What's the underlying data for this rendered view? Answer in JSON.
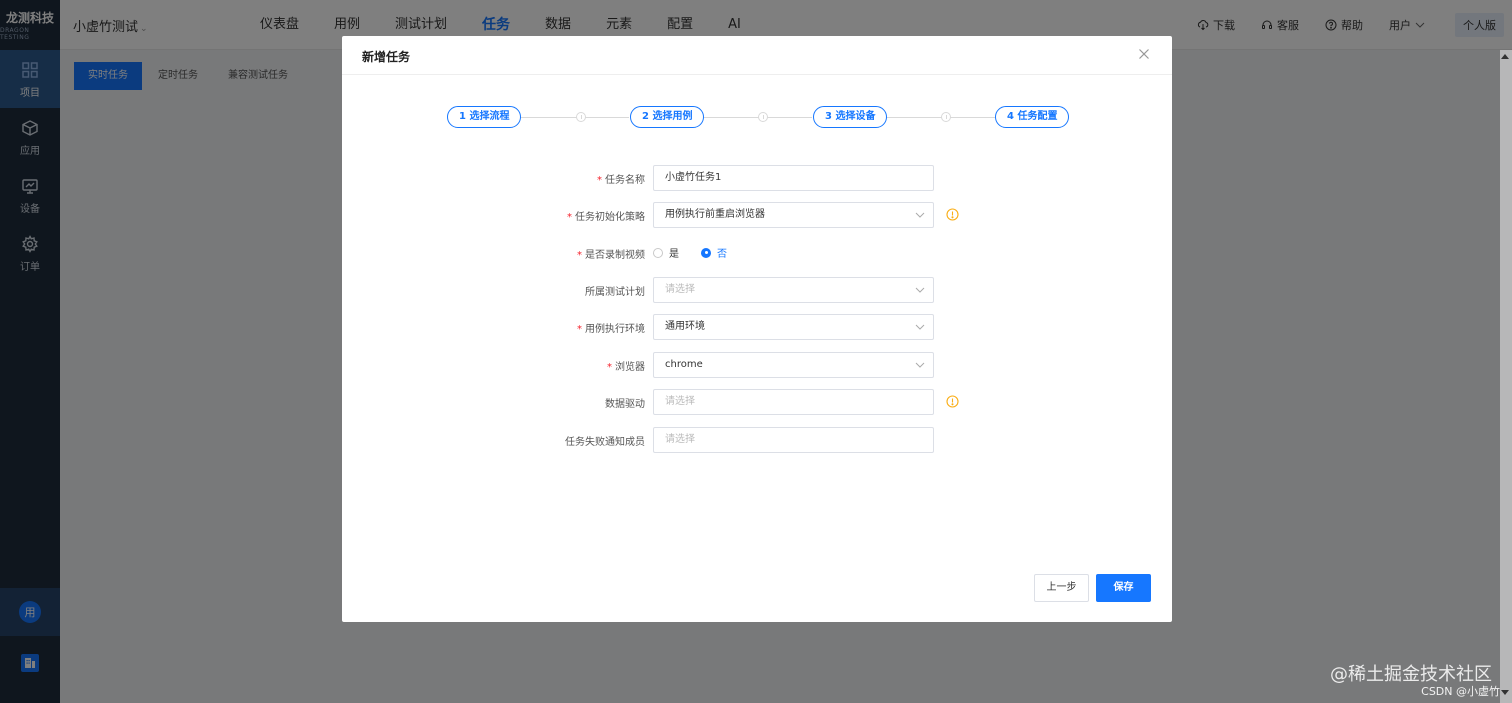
{
  "app": {
    "logo_text": "龙测科技",
    "logo_subtext": "DRAGON TESTING",
    "project_name": "小虚竹测试"
  },
  "sidebar": {
    "items": [
      {
        "label": "项目",
        "icon": "grid-icon",
        "active": true
      },
      {
        "label": "应用",
        "icon": "cube-icon",
        "active": false
      },
      {
        "label": "设备",
        "icon": "monitor-icon",
        "active": false
      },
      {
        "label": "订单",
        "icon": "gear-icon",
        "active": false
      }
    ],
    "user_avatar": "用"
  },
  "nav": {
    "items": [
      "仪表盘",
      "用例",
      "测试计划",
      "任务",
      "数据",
      "元素",
      "配置",
      "AI"
    ],
    "active": "任务"
  },
  "toolbar": {
    "download": "下载",
    "support": "客服",
    "help": "帮助",
    "user": "用户",
    "version": "个人版"
  },
  "subtabs": [
    "实时任务",
    "定时任务",
    "兼容测试任务"
  ],
  "modal": {
    "title": "新增任务",
    "steps": [
      "1 选择流程",
      "2 选择用例",
      "3 选择设备",
      "4 任务配置"
    ],
    "form": {
      "task_name": {
        "label": "任务名称",
        "value": "小虚竹任务1"
      },
      "init_strategy": {
        "label": "任务初始化策略",
        "value": "用例执行前重启浏览器"
      },
      "record_video": {
        "label": "是否录制视频",
        "options": [
          "是",
          "否"
        ],
        "selected": "否"
      },
      "test_plan": {
        "label": "所属测试计划",
        "placeholder": "请选择"
      },
      "environment": {
        "label": "用例执行环境",
        "value": "通用环境"
      },
      "browser": {
        "label": "浏览器",
        "value": "chrome"
      },
      "data_driven": {
        "label": "数据驱动",
        "placeholder": "请选择"
      },
      "notify_members": {
        "label": "任务失败通知成员",
        "placeholder": "请选择"
      }
    },
    "buttons": {
      "prev": "上一步",
      "save": "保存"
    }
  },
  "watermark": {
    "line1": "@稀土掘金技术社区",
    "line2": "CSDN @小虚竹"
  },
  "colors": {
    "primary": "#1677ff",
    "sidebar": "#1f2d3d",
    "required": "#f5222d",
    "warning": "#faad14"
  }
}
